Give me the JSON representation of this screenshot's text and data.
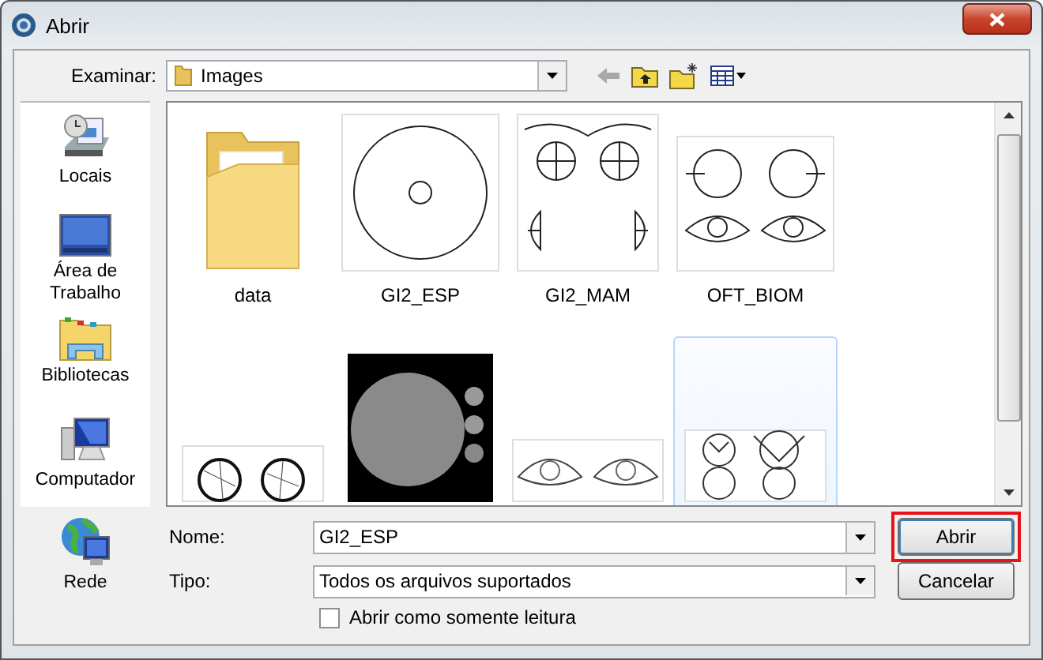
{
  "window": {
    "title": "Abrir"
  },
  "look_in": {
    "label": "Examinar:",
    "value": "Images"
  },
  "toolbar": [
    {
      "kind": "back",
      "disabled": true
    },
    {
      "kind": "up",
      "disabled": false
    },
    {
      "kind": "new-folder",
      "disabled": false
    },
    {
      "kind": "views",
      "disabled": false
    }
  ],
  "places": [
    {
      "label": "Locais",
      "kind": "recent"
    },
    {
      "label": "Área de Trabalho",
      "kind": "desktop"
    },
    {
      "label": "Bibliotecas",
      "kind": "libraries"
    },
    {
      "label": "Computador",
      "kind": "computer"
    },
    {
      "label": "Rede",
      "kind": "network"
    }
  ],
  "files": [
    {
      "name": "data",
      "kind": "folder",
      "selected": false
    },
    {
      "name": "GI2_ESP",
      "kind": "circle",
      "selected": false
    },
    {
      "name": "GI2_MAM",
      "kind": "breast",
      "selected": false
    },
    {
      "name": "OFT_BIOM",
      "kind": "eyes",
      "selected": false
    },
    {
      "kind": "fundus",
      "selected": false
    },
    {
      "kind": "photo",
      "selected": false
    },
    {
      "kind": "eyelid",
      "selected": false
    },
    {
      "kind": "organ",
      "selected": true
    }
  ],
  "file_name": {
    "label": "Nome:",
    "value": "GI2_ESP"
  },
  "file_type": {
    "label": "Tipo:",
    "value": "Todos os arquivos suportados"
  },
  "read_only": {
    "label": "Abrir como somente leitura",
    "checked": false
  },
  "buttons": [
    {
      "label": "Abrir",
      "highlighted": true
    },
    {
      "label": "Cancelar",
      "highlighted": false
    }
  ]
}
